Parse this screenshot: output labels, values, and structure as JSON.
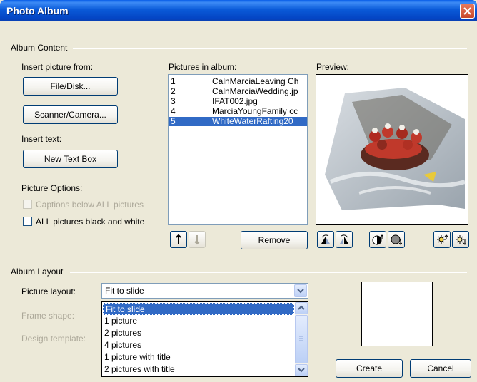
{
  "window": {
    "title": "Photo Album"
  },
  "album_content": {
    "group_label": "Album Content",
    "insert_picture_label": "Insert picture from:",
    "file_disk_button": "File/Disk...",
    "scanner_camera_button": "Scanner/Camera...",
    "insert_text_label": "Insert text:",
    "new_text_box_button": "New Text Box",
    "picture_options_label": "Picture Options:",
    "captions_option": "Captions below ALL pictures",
    "black_white_option": "ALL pictures black and white",
    "pictures_in_album_label": "Pictures in album:",
    "pictures": [
      {
        "num": "1",
        "name": "CalnMarciaLeaving Ch"
      },
      {
        "num": "2",
        "name": "CalnMarciaWedding.jp"
      },
      {
        "num": "3",
        "name": "IFAT002.jpg"
      },
      {
        "num": "4",
        "name": "MarciaYoungFamily cc"
      },
      {
        "num": "5",
        "name": "WhiteWaterRafting20"
      }
    ],
    "selected_picture": "5",
    "remove_button": "Remove",
    "preview_label": "Preview:"
  },
  "album_layout": {
    "group_label": "Album Layout",
    "picture_layout_label": "Picture layout:",
    "picture_layout_value": "Fit to slide",
    "frame_shape_label": "Frame shape:",
    "design_template_label": "Design template:",
    "layout_options": [
      "Fit to slide",
      "1 picture",
      "2 pictures",
      "4 pictures",
      "1 picture with title",
      "2 pictures with title"
    ],
    "create_button": "Create",
    "cancel_button": "Cancel"
  }
}
